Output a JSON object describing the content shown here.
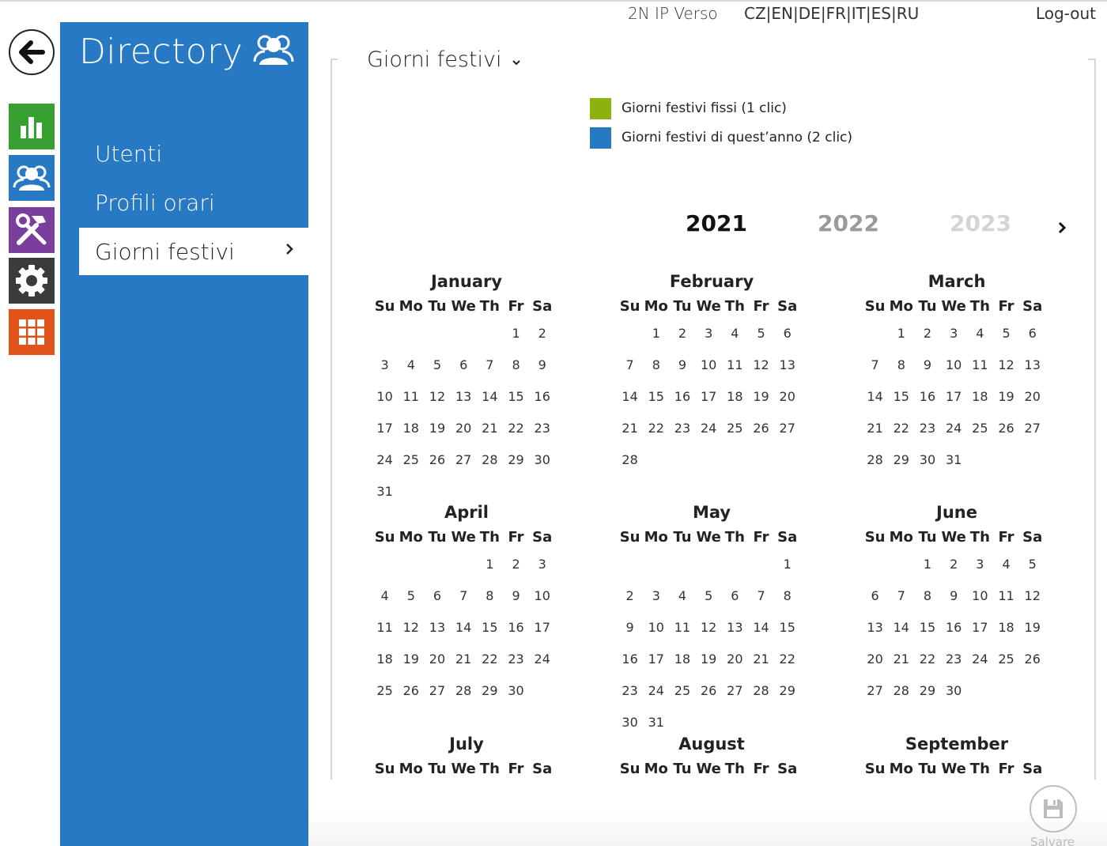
{
  "topbar": {
    "device": "2N IP Verso",
    "languages": [
      "CZ",
      "EN",
      "DE",
      "FR",
      "IT",
      "ES",
      "RU"
    ],
    "logout": "Log-out"
  },
  "nav_icons": [
    "back-arrow-icon",
    "status-chart-icon",
    "directory-users-icon",
    "hardware-tools-icon",
    "services-gear-icon",
    "system-grid-icon"
  ],
  "colors": {
    "status": "#35a02f",
    "directory": "#2779c4",
    "hardware": "#7a3f9d",
    "services": "#3b3b3b",
    "system": "#e0541b",
    "fixed": "#8db10f",
    "this_year": "#2779c4"
  },
  "sidebar": {
    "title": "Directory",
    "items": [
      {
        "label": "Utenti"
      },
      {
        "label": "Profili orari"
      },
      {
        "label": "Giorni festivi"
      }
    ]
  },
  "main": {
    "title": "Giorni festivi",
    "legend": [
      {
        "label": "Giorni festivi fissi (1 clic)"
      },
      {
        "label": "Giorni festivi di quest’anno (2 clic)"
      }
    ],
    "years": [
      "2021",
      "2022",
      "2023"
    ],
    "weekdays": [
      "Su",
      "Mo",
      "Tu",
      "We",
      "Th",
      "Fr",
      "Sa"
    ],
    "months": [
      {
        "name": "January",
        "offset": 5,
        "days": 31
      },
      {
        "name": "February",
        "offset": 1,
        "days": 28
      },
      {
        "name": "March",
        "offset": 1,
        "days": 31
      },
      {
        "name": "April",
        "offset": 4,
        "days": 30
      },
      {
        "name": "May",
        "offset": 6,
        "days": 31
      },
      {
        "name": "June",
        "offset": 2,
        "days": 30
      },
      {
        "name": "July",
        "offset": 4,
        "days": 0
      },
      {
        "name": "August",
        "offset": 0,
        "days": 0
      },
      {
        "name": "September",
        "offset": 3,
        "days": 0
      }
    ],
    "save_label": "Salvare"
  }
}
